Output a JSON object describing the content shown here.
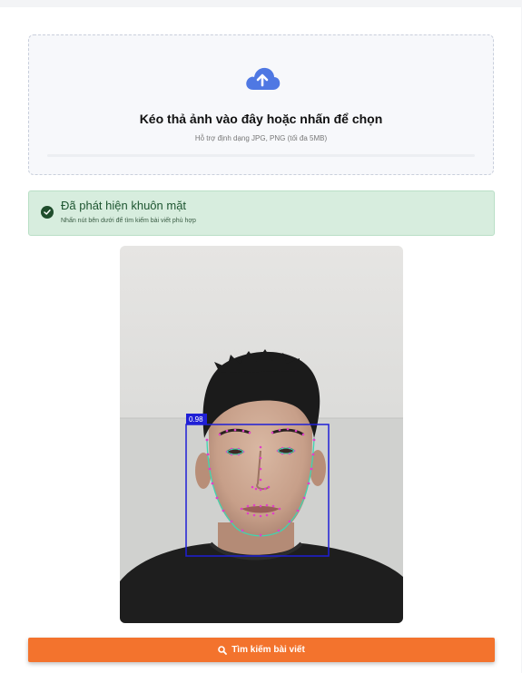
{
  "upload": {
    "title": "Kéo thả ảnh vào đây hoặc nhấn để chọn",
    "subtitle": "Hỗ trợ định dạng JPG, PNG (tối đa 5MB)",
    "icon": "cloud-upload-icon",
    "accent_color": "#4f78e3"
  },
  "alert": {
    "title": "Đã phát hiện khuôn mặt",
    "subtitle": "Nhấn nút bên dưới để tìm kiếm bài viết phù hợp",
    "icon": "check-circle-icon",
    "color": "#1e5631"
  },
  "detection": {
    "confidence_label": "0.98",
    "box_color": "#1f1fd6",
    "landmark_color": "#e040c8",
    "contour_color": "#3fd6b0"
  },
  "search_button": {
    "label": "Tìm kiếm bài viết",
    "icon": "search-icon",
    "color": "#f3732d"
  }
}
